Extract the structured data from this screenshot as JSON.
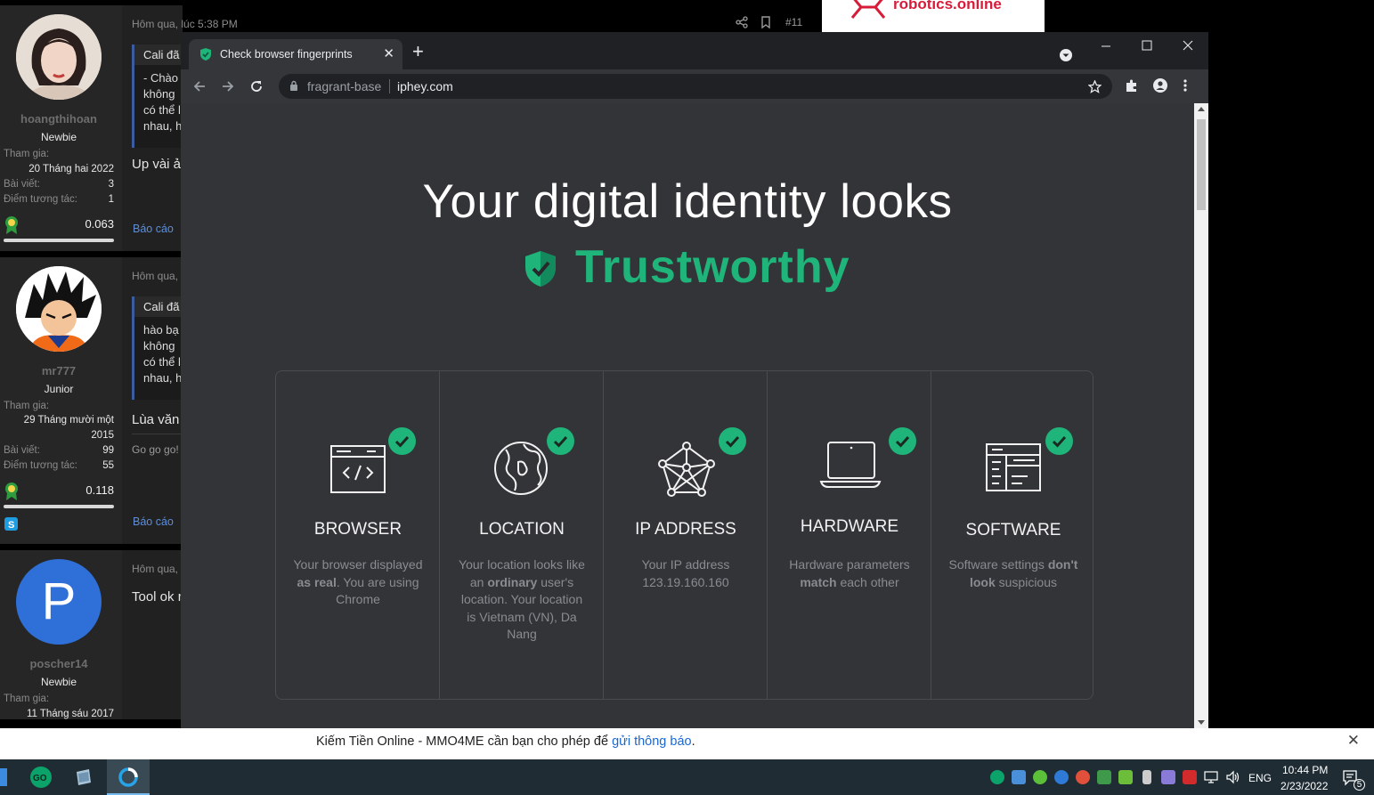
{
  "forum": {
    "posts": [
      {
        "username": "hoangthihoan",
        "rank": "Newbie",
        "joined_label": "Tham gia:",
        "joined_value": "20 Tháng hai 2022",
        "posts_label": "Bài viết:",
        "posts_value": "3",
        "score_label": "Điểm tương tác:",
        "score_value": "1",
        "reputation": "0.063",
        "time": "Hôm qua, lúc 5:38 PM",
        "post_number": "#11",
        "quote_header": "Cali đã",
        "quote_lines": [
          "- Chào",
          "không",
          "có thể l",
          "nhau, h"
        ],
        "text": "Up vài ả",
        "report": "Báo cáo"
      },
      {
        "username": "mr777",
        "rank": "Junior",
        "joined_label": "Tham gia:",
        "joined_value_1": "29 Tháng mười một",
        "joined_value_2": "2015",
        "posts_label": "Bài viết:",
        "posts_value": "99",
        "score_label": "Điểm tương tác:",
        "score_value": "55",
        "reputation": "0.118",
        "time": "Hôm qua,",
        "quote_header": "Cali đã",
        "quote_lines": [
          "hào bạ",
          "không",
          "có thể l",
          "nhau, h"
        ],
        "text": "Lùa văn",
        "extra": "Go go go!",
        "report": "Báo cáo"
      },
      {
        "username": "poscher14",
        "avatar_letter": "P",
        "rank": "Newbie",
        "joined_label": "Tham gia:",
        "joined_value": "11 Tháng sáu 2017",
        "time": "Hôm qua,",
        "text": "Tool ok r"
      }
    ],
    "ad_text": "robotics.online"
  },
  "browser": {
    "tab_title": "Check browser fingerprints",
    "url_subdomain": "fragrant-base",
    "url_domain": "iphey.com"
  },
  "page": {
    "headline": "Your digital identity looks",
    "verdict": "Trustworthy",
    "accent": "#1fb47a",
    "cards": [
      {
        "icon": "browser-code-icon",
        "title": "BROWSER",
        "desc_html_parts": [
          "Your browser displayed ",
          "as real",
          ". You are using Chrome"
        ]
      },
      {
        "icon": "globe-icon",
        "title": "LOCATION",
        "desc_html_parts": [
          "Your location looks like an ",
          "ordinary",
          " user's location. Your location is Vietnam (VN), Da Nang"
        ]
      },
      {
        "icon": "network-icon",
        "title": "IP ADDRESS",
        "desc_html_parts": [
          "Your IP address 123.19.160.160",
          "",
          ""
        ]
      },
      {
        "icon": "laptop-icon",
        "title": "HARDWARE",
        "desc_html_parts": [
          "Hardware parameters ",
          "match",
          " each other"
        ]
      },
      {
        "icon": "window-settings-icon",
        "title": "SOFTWARE",
        "desc_html_parts": [
          "Software settings ",
          "don't look",
          " suspicious"
        ]
      }
    ]
  },
  "notification": {
    "text": "Kiếm Tiền Online - MMO4ME cần bạn cho phép để ",
    "link": "gửi thông báo",
    "end": "."
  },
  "taskbar": {
    "language": "ENG",
    "time": "10:44 PM",
    "date": "2/23/2022",
    "notification_count": "5"
  }
}
